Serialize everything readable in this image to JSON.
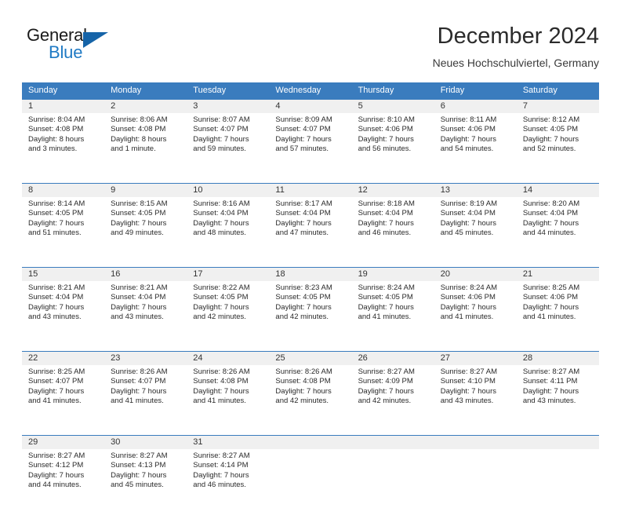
{
  "brand": {
    "word1": "General",
    "word2": "Blue",
    "triangle_color": "#1664a8",
    "blue_text_color": "#1f7ac4"
  },
  "header": {
    "title": "December 2024",
    "subtitle": "Neues Hochschulviertel, Germany"
  },
  "theme": {
    "header_blue": "#3a7cbe",
    "daynum_band": "#f0f0f0",
    "text": "#2a2a2a"
  },
  "calendar": {
    "weekdays": [
      "Sunday",
      "Monday",
      "Tuesday",
      "Wednesday",
      "Thursday",
      "Friday",
      "Saturday"
    ],
    "weeks": [
      [
        {
          "day": "1",
          "sunrise": "Sunrise: 8:04 AM",
          "sunset": "Sunset: 4:08 PM",
          "daylight1": "Daylight: 8 hours",
          "daylight2": "and 3 minutes."
        },
        {
          "day": "2",
          "sunrise": "Sunrise: 8:06 AM",
          "sunset": "Sunset: 4:08 PM",
          "daylight1": "Daylight: 8 hours",
          "daylight2": "and 1 minute."
        },
        {
          "day": "3",
          "sunrise": "Sunrise: 8:07 AM",
          "sunset": "Sunset: 4:07 PM",
          "daylight1": "Daylight: 7 hours",
          "daylight2": "and 59 minutes."
        },
        {
          "day": "4",
          "sunrise": "Sunrise: 8:09 AM",
          "sunset": "Sunset: 4:07 PM",
          "daylight1": "Daylight: 7 hours",
          "daylight2": "and 57 minutes."
        },
        {
          "day": "5",
          "sunrise": "Sunrise: 8:10 AM",
          "sunset": "Sunset: 4:06 PM",
          "daylight1": "Daylight: 7 hours",
          "daylight2": "and 56 minutes."
        },
        {
          "day": "6",
          "sunrise": "Sunrise: 8:11 AM",
          "sunset": "Sunset: 4:06 PM",
          "daylight1": "Daylight: 7 hours",
          "daylight2": "and 54 minutes."
        },
        {
          "day": "7",
          "sunrise": "Sunrise: 8:12 AM",
          "sunset": "Sunset: 4:05 PM",
          "daylight1": "Daylight: 7 hours",
          "daylight2": "and 52 minutes."
        }
      ],
      [
        {
          "day": "8",
          "sunrise": "Sunrise: 8:14 AM",
          "sunset": "Sunset: 4:05 PM",
          "daylight1": "Daylight: 7 hours",
          "daylight2": "and 51 minutes."
        },
        {
          "day": "9",
          "sunrise": "Sunrise: 8:15 AM",
          "sunset": "Sunset: 4:05 PM",
          "daylight1": "Daylight: 7 hours",
          "daylight2": "and 49 minutes."
        },
        {
          "day": "10",
          "sunrise": "Sunrise: 8:16 AM",
          "sunset": "Sunset: 4:04 PM",
          "daylight1": "Daylight: 7 hours",
          "daylight2": "and 48 minutes."
        },
        {
          "day": "11",
          "sunrise": "Sunrise: 8:17 AM",
          "sunset": "Sunset: 4:04 PM",
          "daylight1": "Daylight: 7 hours",
          "daylight2": "and 47 minutes."
        },
        {
          "day": "12",
          "sunrise": "Sunrise: 8:18 AM",
          "sunset": "Sunset: 4:04 PM",
          "daylight1": "Daylight: 7 hours",
          "daylight2": "and 46 minutes."
        },
        {
          "day": "13",
          "sunrise": "Sunrise: 8:19 AM",
          "sunset": "Sunset: 4:04 PM",
          "daylight1": "Daylight: 7 hours",
          "daylight2": "and 45 minutes."
        },
        {
          "day": "14",
          "sunrise": "Sunrise: 8:20 AM",
          "sunset": "Sunset: 4:04 PM",
          "daylight1": "Daylight: 7 hours",
          "daylight2": "and 44 minutes."
        }
      ],
      [
        {
          "day": "15",
          "sunrise": "Sunrise: 8:21 AM",
          "sunset": "Sunset: 4:04 PM",
          "daylight1": "Daylight: 7 hours",
          "daylight2": "and 43 minutes."
        },
        {
          "day": "16",
          "sunrise": "Sunrise: 8:21 AM",
          "sunset": "Sunset: 4:04 PM",
          "daylight1": "Daylight: 7 hours",
          "daylight2": "and 43 minutes."
        },
        {
          "day": "17",
          "sunrise": "Sunrise: 8:22 AM",
          "sunset": "Sunset: 4:05 PM",
          "daylight1": "Daylight: 7 hours",
          "daylight2": "and 42 minutes."
        },
        {
          "day": "18",
          "sunrise": "Sunrise: 8:23 AM",
          "sunset": "Sunset: 4:05 PM",
          "daylight1": "Daylight: 7 hours",
          "daylight2": "and 42 minutes."
        },
        {
          "day": "19",
          "sunrise": "Sunrise: 8:24 AM",
          "sunset": "Sunset: 4:05 PM",
          "daylight1": "Daylight: 7 hours",
          "daylight2": "and 41 minutes."
        },
        {
          "day": "20",
          "sunrise": "Sunrise: 8:24 AM",
          "sunset": "Sunset: 4:06 PM",
          "daylight1": "Daylight: 7 hours",
          "daylight2": "and 41 minutes."
        },
        {
          "day": "21",
          "sunrise": "Sunrise: 8:25 AM",
          "sunset": "Sunset: 4:06 PM",
          "daylight1": "Daylight: 7 hours",
          "daylight2": "and 41 minutes."
        }
      ],
      [
        {
          "day": "22",
          "sunrise": "Sunrise: 8:25 AM",
          "sunset": "Sunset: 4:07 PM",
          "daylight1": "Daylight: 7 hours",
          "daylight2": "and 41 minutes."
        },
        {
          "day": "23",
          "sunrise": "Sunrise: 8:26 AM",
          "sunset": "Sunset: 4:07 PM",
          "daylight1": "Daylight: 7 hours",
          "daylight2": "and 41 minutes."
        },
        {
          "day": "24",
          "sunrise": "Sunrise: 8:26 AM",
          "sunset": "Sunset: 4:08 PM",
          "daylight1": "Daylight: 7 hours",
          "daylight2": "and 41 minutes."
        },
        {
          "day": "25",
          "sunrise": "Sunrise: 8:26 AM",
          "sunset": "Sunset: 4:08 PM",
          "daylight1": "Daylight: 7 hours",
          "daylight2": "and 42 minutes."
        },
        {
          "day": "26",
          "sunrise": "Sunrise: 8:27 AM",
          "sunset": "Sunset: 4:09 PM",
          "daylight1": "Daylight: 7 hours",
          "daylight2": "and 42 minutes."
        },
        {
          "day": "27",
          "sunrise": "Sunrise: 8:27 AM",
          "sunset": "Sunset: 4:10 PM",
          "daylight1": "Daylight: 7 hours",
          "daylight2": "and 43 minutes."
        },
        {
          "day": "28",
          "sunrise": "Sunrise: 8:27 AM",
          "sunset": "Sunset: 4:11 PM",
          "daylight1": "Daylight: 7 hours",
          "daylight2": "and 43 minutes."
        }
      ],
      [
        {
          "day": "29",
          "sunrise": "Sunrise: 8:27 AM",
          "sunset": "Sunset: 4:12 PM",
          "daylight1": "Daylight: 7 hours",
          "daylight2": "and 44 minutes."
        },
        {
          "day": "30",
          "sunrise": "Sunrise: 8:27 AM",
          "sunset": "Sunset: 4:13 PM",
          "daylight1": "Daylight: 7 hours",
          "daylight2": "and 45 minutes."
        },
        {
          "day": "31",
          "sunrise": "Sunrise: 8:27 AM",
          "sunset": "Sunset: 4:14 PM",
          "daylight1": "Daylight: 7 hours",
          "daylight2": "and 46 minutes."
        },
        {
          "day": "",
          "sunrise": "",
          "sunset": "",
          "daylight1": "",
          "daylight2": ""
        },
        {
          "day": "",
          "sunrise": "",
          "sunset": "",
          "daylight1": "",
          "daylight2": ""
        },
        {
          "day": "",
          "sunrise": "",
          "sunset": "",
          "daylight1": "",
          "daylight2": ""
        },
        {
          "day": "",
          "sunrise": "",
          "sunset": "",
          "daylight1": "",
          "daylight2": ""
        }
      ]
    ]
  }
}
